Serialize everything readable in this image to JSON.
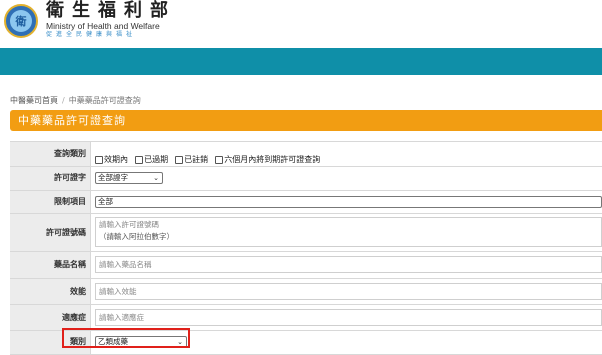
{
  "header": {
    "logo_glyph": "衛",
    "brand_zh": "衛生福利部",
    "brand_en": "Ministry of Health and Welfare",
    "slogan": "促進全民健康與福祉"
  },
  "breadcrumb": {
    "home": "中醫藥司首頁",
    "separator": "/",
    "current": "中藥藥品許可證查詢"
  },
  "page_title": "中藥藥品許可證查詢",
  "form": {
    "query_type": {
      "label": "查詢類別",
      "options": [
        "效期內",
        "已過期",
        "已註銷",
        "六個月內將到期許可證查詢"
      ]
    },
    "license_prefix": {
      "label": "許可證字",
      "value": "全部證字"
    },
    "restriction": {
      "label": "限制項目",
      "value": "全部"
    },
    "license_number": {
      "label": "許可證號碼",
      "placeholder_line1": "請輸入許可證號碼",
      "placeholder_line2": "（請輸入阿拉伯數字）"
    },
    "drug_name": {
      "label": "藥品名稱",
      "placeholder": "請輸入藥品名稱"
    },
    "efficacy": {
      "label": "效能",
      "placeholder": "請輸入效能"
    },
    "indication": {
      "label": "適應症",
      "placeholder": "請輸入適應症"
    },
    "category": {
      "label": "類別",
      "value": "乙類成藥"
    }
  },
  "colors": {
    "teal_bar": "#0f8fa8",
    "title_bar": "#f29d12",
    "highlight_border": "#e0201a"
  }
}
